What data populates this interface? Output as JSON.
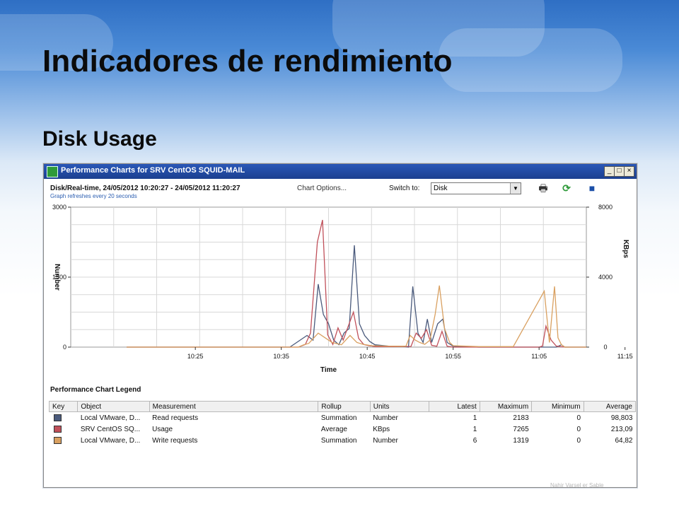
{
  "slide": {
    "title": "Indicadores de rendimiento",
    "subtitle": "Disk Usage"
  },
  "window": {
    "title": "Performance Charts for SRV CentOS SQUID-MAIL",
    "buttons": {
      "minimize": "_",
      "maximize": "□",
      "close": "×"
    },
    "header": "Disk/Real-time, 24/05/2012 10:20:27 - 24/05/2012 11:20:27",
    "chart_options": "Chart Options...",
    "refresh_note": "Graph refreshes every 20 seconds",
    "switch_label": "Switch to:",
    "switch_value": "Disk",
    "icons": [
      "print-icon",
      "refresh-icon",
      "save-icon"
    ]
  },
  "chart_data": {
    "type": "line",
    "xlabel": "Time",
    "ylabel": "Number",
    "y2label": "KBps",
    "ylim": [
      0,
      3000
    ],
    "y2lim": [
      0,
      8000
    ],
    "yticks": [
      "3000",
      "1500",
      "0"
    ],
    "y2ticks": [
      "8000",
      "4000",
      "0"
    ],
    "xticks": [
      "10:25",
      "10:35",
      "10:45",
      "10:55",
      "11:05",
      "11:15"
    ],
    "x_range_minutes": [
      10.5,
      70.5
    ],
    "grid": true,
    "series": [
      {
        "name": "Read requests",
        "color": "#4a5a7c",
        "axis": "left",
        "points": [
          [
            17,
            0
          ],
          [
            36,
            0
          ],
          [
            38,
            250
          ],
          [
            38.7,
            150
          ],
          [
            39.3,
            1350
          ],
          [
            39.9,
            700
          ],
          [
            40.5,
            500
          ],
          [
            41.1,
            150
          ],
          [
            41.7,
            50
          ],
          [
            42.3,
            300
          ],
          [
            42.9,
            400
          ],
          [
            43.5,
            2183
          ],
          [
            44.1,
            500
          ],
          [
            44.7,
            250
          ],
          [
            45.3,
            120
          ],
          [
            45.9,
            50
          ],
          [
            47.5,
            20
          ],
          [
            49,
            20
          ],
          [
            49.8,
            0
          ],
          [
            50.3,
            1300
          ],
          [
            50.9,
            300
          ],
          [
            51.5,
            100
          ],
          [
            52,
            600
          ],
          [
            52.5,
            100
          ],
          [
            53.2,
            500
          ],
          [
            53.8,
            600
          ],
          [
            54.3,
            100
          ],
          [
            55,
            20
          ],
          [
            58,
            0
          ],
          [
            67,
            0
          ],
          [
            67.6,
            50
          ],
          [
            68,
            0
          ],
          [
            70.5,
            0
          ]
        ]
      },
      {
        "name": "Usage",
        "color": "#c0505a",
        "axis": "right",
        "points": [
          [
            17,
            0
          ],
          [
            37,
            0
          ],
          [
            37.8,
            150
          ],
          [
            38.4,
            800
          ],
          [
            39.2,
            6000
          ],
          [
            39.8,
            7265
          ],
          [
            40.4,
            700
          ],
          [
            41,
            150
          ],
          [
            41.6,
            1100
          ],
          [
            42.2,
            400
          ],
          [
            42.8,
            1200
          ],
          [
            43.4,
            2000
          ],
          [
            44,
            500
          ],
          [
            44.6,
            150
          ],
          [
            45.2,
            80
          ],
          [
            46,
            30
          ],
          [
            48,
            30
          ],
          [
            50.1,
            40
          ],
          [
            50.7,
            800
          ],
          [
            51.3,
            500
          ],
          [
            51.9,
            1000
          ],
          [
            52.5,
            100
          ],
          [
            53.1,
            50
          ],
          [
            53.7,
            900
          ],
          [
            54.3,
            50
          ],
          [
            55,
            0
          ],
          [
            65,
            0
          ],
          [
            65.4,
            60
          ],
          [
            65.8,
            1200
          ],
          [
            66.4,
            400
          ],
          [
            67,
            60
          ],
          [
            68,
            0
          ],
          [
            70.5,
            0
          ]
        ]
      },
      {
        "name": "Write requests",
        "color": "#d9a060",
        "axis": "left",
        "points": [
          [
            17,
            0
          ],
          [
            37,
            0
          ],
          [
            37.6,
            50
          ],
          [
            38.2,
            80
          ],
          [
            39.3,
            300
          ],
          [
            40.1,
            200
          ],
          [
            40.9,
            100
          ],
          [
            42,
            50
          ],
          [
            43,
            250
          ],
          [
            43.8,
            100
          ],
          [
            44.5,
            60
          ],
          [
            45.5,
            30
          ],
          [
            47.5,
            20
          ],
          [
            49.5,
            20
          ],
          [
            50,
            250
          ],
          [
            50.6,
            150
          ],
          [
            51.1,
            100
          ],
          [
            51.7,
            60
          ],
          [
            52.3,
            150
          ],
          [
            52.9,
            700
          ],
          [
            53.4,
            1319
          ],
          [
            54,
            400
          ],
          [
            54.6,
            100
          ],
          [
            55,
            30
          ],
          [
            58,
            10
          ],
          [
            62,
            10
          ],
          [
            65.6,
            1200
          ],
          [
            66.2,
            100
          ],
          [
            66.8,
            1300
          ],
          [
            67.2,
            200
          ],
          [
            67.6,
            50
          ],
          [
            68,
            0
          ],
          [
            70.5,
            0
          ]
        ]
      }
    ]
  },
  "legend": {
    "title": "Performance Chart Legend",
    "columns": [
      "Key",
      "Object",
      "Measurement",
      "Rollup",
      "Units",
      "Latest",
      "Maximum",
      "Minimum",
      "Average"
    ],
    "rows": [
      {
        "color": "#4a5a7c",
        "object": "Local VMware, D...",
        "measurement": "Read requests",
        "rollup": "Summation",
        "units": "Number",
        "latest": "1",
        "maximum": "2183",
        "minimum": "0",
        "average": "98,803"
      },
      {
        "color": "#c0505a",
        "object": "SRV CentOS SQ...",
        "measurement": "Usage",
        "rollup": "Average",
        "units": "KBps",
        "latest": "1",
        "maximum": "7265",
        "minimum": "0",
        "average": "213,09"
      },
      {
        "color": "#d9a060",
        "object": "Local VMware, D...",
        "measurement": "Write requests",
        "rollup": "Summation",
        "units": "Number",
        "latest": "6",
        "maximum": "1319",
        "minimum": "0",
        "average": "64,82"
      }
    ]
  },
  "footer_text": "Nahir Varsel er Sable"
}
